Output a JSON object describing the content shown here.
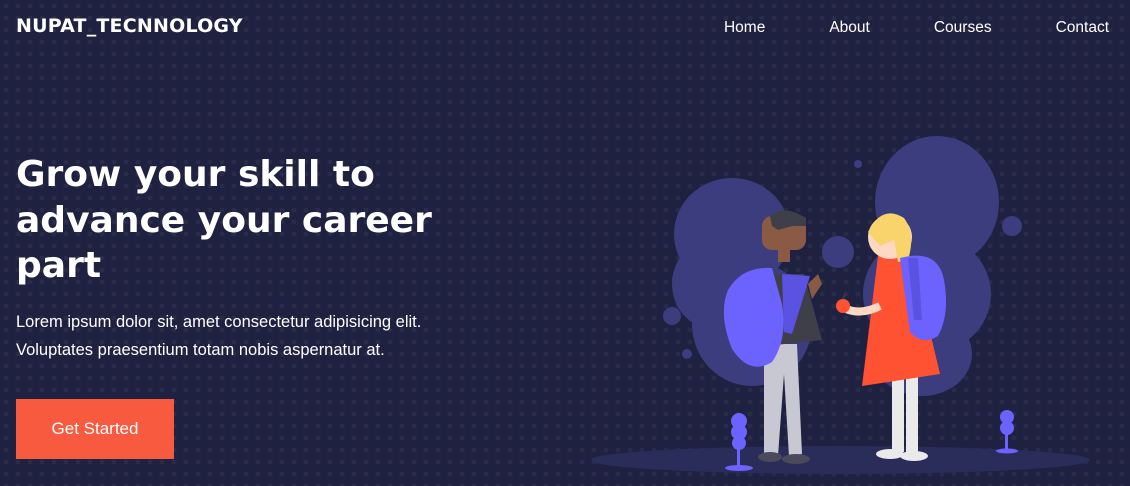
{
  "nav": {
    "brand": "NUPAT_TECNNOLOGY",
    "links": [
      {
        "label": "Home"
      },
      {
        "label": "About"
      },
      {
        "label": "Courses"
      },
      {
        "label": "Contact"
      }
    ]
  },
  "hero": {
    "title": "Grow your skill to advance your career part",
    "text_line1": "Lorem ipsum dolor sit, amet consectetur adipisicing elit.",
    "text_line2": "Voluptates praesentium totam nobis aspernatur at.",
    "cta_label": "Get Started"
  },
  "illustration": {
    "name": "students-with-backpacks-illustration",
    "colors": {
      "blob": "#3b3d7e",
      "accent": "#6c63ff",
      "dress": "#ff5233",
      "hair": "#f9d46b",
      "skin_boy": "#8a5a44",
      "skin_girl": "#ffd8c4",
      "pants": "#c8c8d2"
    }
  },
  "colors": {
    "background": "#1f2140",
    "cta": "#f85a40",
    "text": "#ffffff"
  }
}
